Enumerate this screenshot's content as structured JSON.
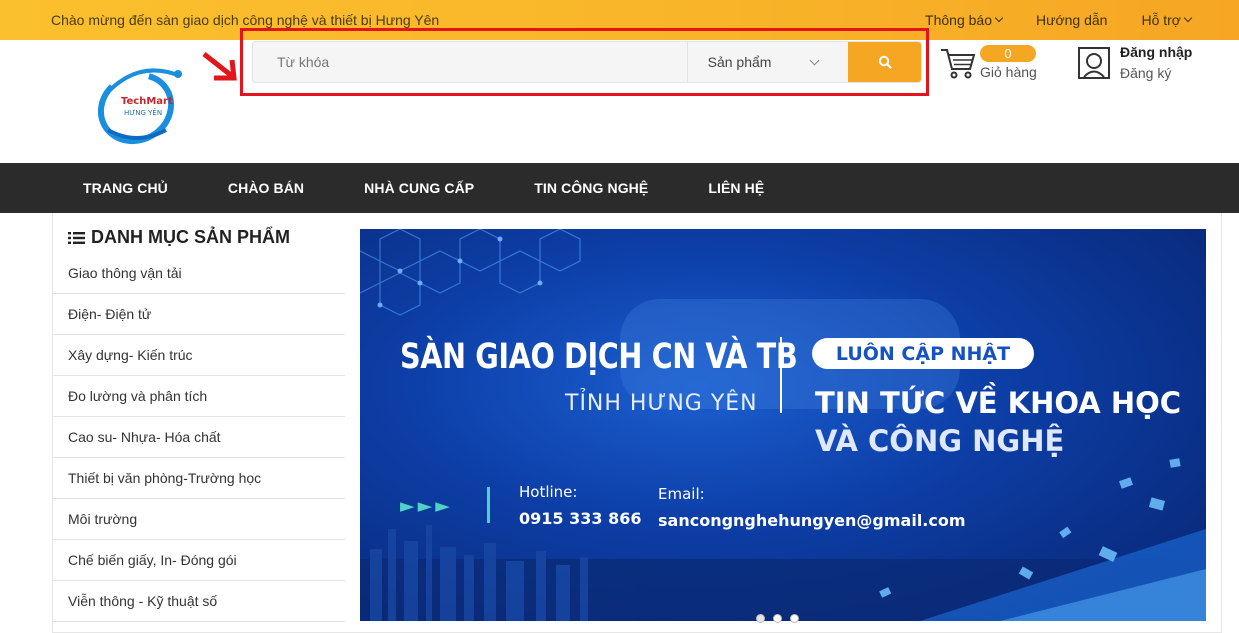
{
  "topbar": {
    "welcome": "Chào mừng đến sàn giao dịch công nghệ và thiết bị Hưng Yên",
    "links": [
      "Thông báo",
      "Hướng dẫn",
      "Hỗ trợ"
    ]
  },
  "logo": {
    "line1": "TechMart",
    "line2": "HƯNG YÊN"
  },
  "search": {
    "placeholder": "Từ khóa",
    "category": "Sản phẩm"
  },
  "cart": {
    "count": "0",
    "label": "Giỏ hàng"
  },
  "account": {
    "login": "Đăng nhập",
    "register": "Đăng ký"
  },
  "nav": [
    "TRANG CHỦ",
    "CHÀO BÁN",
    "NHÀ CUNG CẤP",
    "TIN CÔNG NGHỆ",
    "LIÊN HỆ"
  ],
  "categories": {
    "title": "DANH MỤC SẢN PHẨM",
    "items": [
      "Giao thông vận tải",
      "Điện- Điện tử",
      "Xây dựng- Kiến trúc",
      "Đo lường và phân tích",
      "Cao su- Nhựa- Hóa chất",
      "Thiết bị văn phòng-Trường học",
      "Môi trường",
      "Chế biến giấy, In- Đóng gói",
      "Viễn thông - Kỹ thuật số"
    ]
  },
  "banner": {
    "heading": "SÀN GIAO DỊCH CN VÀ TB",
    "subheading": "TỈNH HƯNG YÊN",
    "badge": "LUÔN CẬP NHẬT",
    "news_line1": "TIN TỨC VỀ KHOA HỌC",
    "news_line2": "VÀ CÔNG NGHỆ",
    "arrows": "►►►",
    "hotline_label": "Hotline:",
    "hotline": "0915 333 866",
    "email_label": "Email:",
    "email": "sancongnghehungyen@gmail.com"
  },
  "colors": {
    "accent": "#f5a623",
    "nav_bg": "#2b2b2b",
    "highlight": "#e3141b"
  }
}
